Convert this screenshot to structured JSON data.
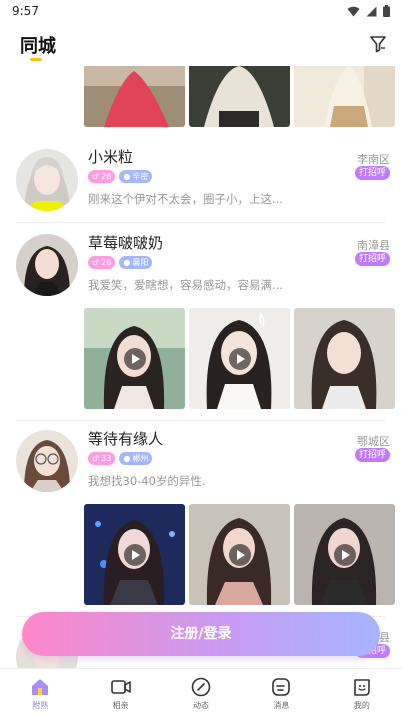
{
  "status_bar": {
    "time": "9:57",
    "icons": [
      "wifi-icon",
      "signal-icon",
      "battery-icon"
    ]
  },
  "header": {
    "title": "同城",
    "filter_icon": "filter-icon",
    "accent_color": "#ffc21a"
  },
  "users": [
    {
      "name": "小米粒",
      "age": "28",
      "city_tag": "辛密",
      "bio": "刚来这个伊对不太会，圈子小，上这...",
      "location": "李南区",
      "greet_label": "打招呼"
    },
    {
      "name": "草莓啵啵奶",
      "age": "26",
      "city_tag": "襄阳",
      "bio": "我爱笑，爱瞎想，容易感动，容易满...",
      "location": "南漳县",
      "greet_label": "打招呼"
    },
    {
      "name": "等待有缘人",
      "age": "33",
      "city_tag": "郴州",
      "bio": "我想找30-40岁的异性.",
      "location": "鄂城区",
      "greet_label": "打招呼"
    },
    {
      "location": "通县",
      "greet_label": "打招呼"
    }
  ],
  "cta": {
    "label": "注册/登录"
  },
  "tabbar": {
    "items": [
      {
        "label": "附熟",
        "icon": "home-icon",
        "active": true
      },
      {
        "label": "相亲",
        "icon": "video-icon",
        "active": false
      },
      {
        "label": "动态",
        "icon": "compass-icon",
        "active": false
      },
      {
        "label": "消息",
        "icon": "message-icon",
        "active": false
      },
      {
        "label": "我的",
        "icon": "profile-icon",
        "active": false
      }
    ]
  },
  "colors": {
    "age_tag": "#ff9be0",
    "city_tag": "#a4b6ff",
    "greet": "#c07bff",
    "cta_start": "#ff88c8",
    "cta_end": "#a6b5ff"
  }
}
